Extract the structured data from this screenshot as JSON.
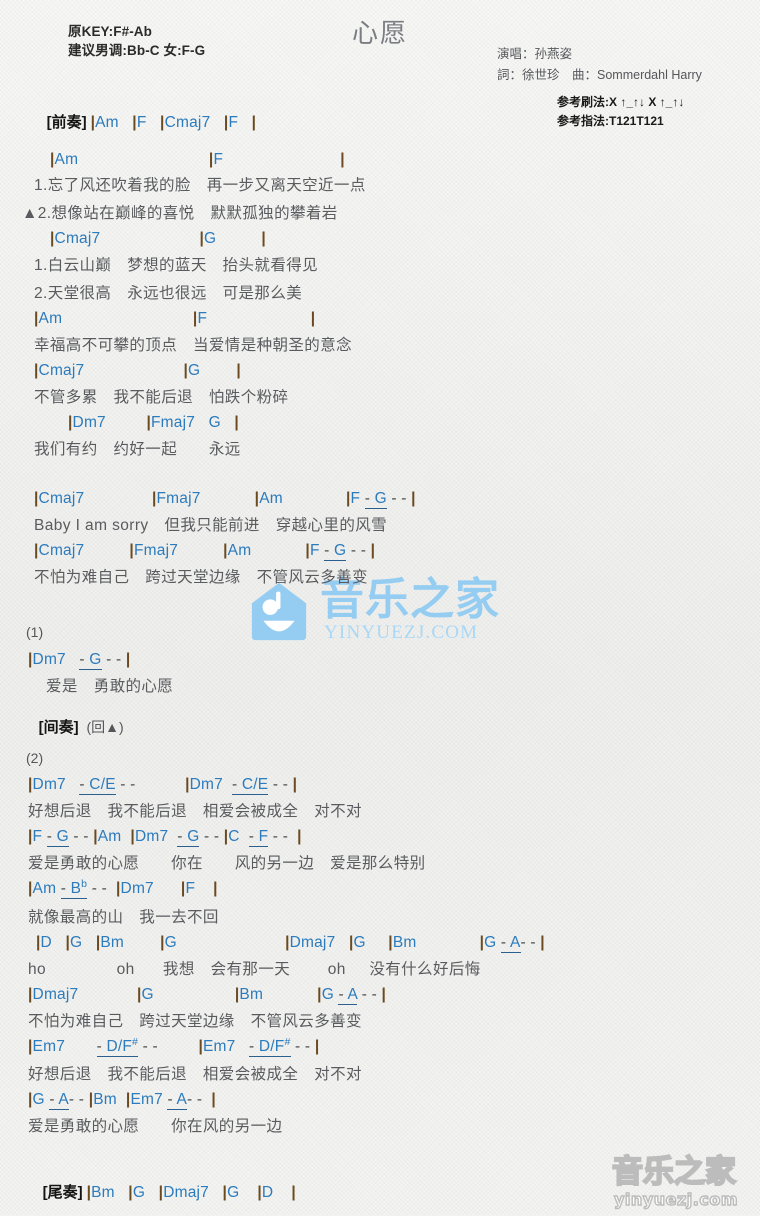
{
  "meta": {
    "title": "心愿",
    "key_line1": "原KEY:F#-Ab",
    "key_line2": "建议男调:Bb-C 女:F-G",
    "singer": "演唱：孙燕姿",
    "writers": "詞：徐世珍　曲：Sommerdahl Harry",
    "strum": "参考刷法:X ↑_↑↓ X ↑_↑↓",
    "picking": "参考指法:T121T121"
  },
  "colors": {
    "chord": "#2b7bbd",
    "lyric": "#5a5b5f",
    "section": "#141414",
    "bar": "#6b4a20",
    "watermark": "#95cdf2",
    "background": "#f2f2f0"
  },
  "watermarks": {
    "mid_cn": "音乐之家",
    "mid_url": "YINYUEZJ.COM",
    "bottom_cn": "音乐之家",
    "bottom_url": "yinyuezj.com"
  },
  "sections": {
    "intro_label": "[前奏]",
    "interlude_label": "[间奏]",
    "interlude_note": "(回▲)",
    "outro_label": "[尾奏]",
    "num1": "(1)",
    "num2": "(2)"
  },
  "lines": {
    "intro_chords": "|Am   |F   |Cmaj7   |F   |",
    "v1_c1": "|Am                                    |F                                 |",
    "v1_l1": "1.忘了风还吹着我的脸　再一步又离天空近一点",
    "v1_l2": "▲2.想像站在巅峰的喜悦　默默孤独的攀着岩",
    "v1_c2": "|Cmaj7                            |G            |",
    "v1_l3": "1.白云山巅　梦想的蓝天　抬头就看得见",
    "v1_l4": "2.天堂很高　永远也很远　可是那么美",
    "v2_c1": "|Am                                |F                            |",
    "v2_l1": "幸福高不可攀的顶点　当爱情是种朝圣的意念",
    "v2_c2": "|Cmaj7                         |G        |",
    "v2_l2": "不管多累　我不能后退　怕跌个粉碎",
    "v2_c3": "|Dm7          |Fmaj7   G   |",
    "v2_l3": "我们有约　约好一起　　永远",
    "ch1_c": "|Cmaj7                |Fmaj7            |Am                 |F  - G - - |",
    "ch1_l": "Baby I am sorry　但我只能前进　穿越心里的风雪",
    "ch2_c": "|Cmaj7           |Fmaj7          |Am              |F  - G - - |",
    "ch2_l": "不怕为难自己　跨过天堂边缘　不管风云多善变",
    "p1_c": "|Dm7   - G - - |",
    "p1_l": "爱是　勇敢的心愿",
    "s2_c1": "|Dm7   - C/E - -            |Dm7   - C/E - - |",
    "s2_l1": "好想后退　我不能后退　相爱会被成全　对不对",
    "s2_c2": "|F - G - - |Am  |Dm7  - G - - |C   - F - -  |",
    "s2_l2": "爱是勇敢的心愿　　你在　　风的另一边　爱是那么特别",
    "s2_c3": "|Am  - Bb - -  |Dm7      |F    |",
    "s2_l3": "就像最高的山　我一去不回",
    "s2_c4": "|D   |G   |Bm        |G                        |Dmaj7   |G     |Bm              |G - A - - |",
    "s2_l4": "ho               oh      我想　会有那一天        oh     没有什么好后悔",
    "s2_c5": "|Dmaj7            |G                 |Bm            |G - A - - |",
    "s2_l5": "不怕为难自己　跨过天堂边缘　不管风云多善变",
    "s2_c6": "|Em7       - D/F# - -          |Em7   - D/F# - - |",
    "s2_l6": "好想后退　我不能后退　相爱会被成全　对不对",
    "s2_c7": "|G - A - - |Bm  |Em7 - A - -  |",
    "s2_l7": "爱是勇敢的心愿　　你在风的另一边",
    "outro_chords": "|Bm   |G   |Dmaj7   |G    |D    |"
  }
}
